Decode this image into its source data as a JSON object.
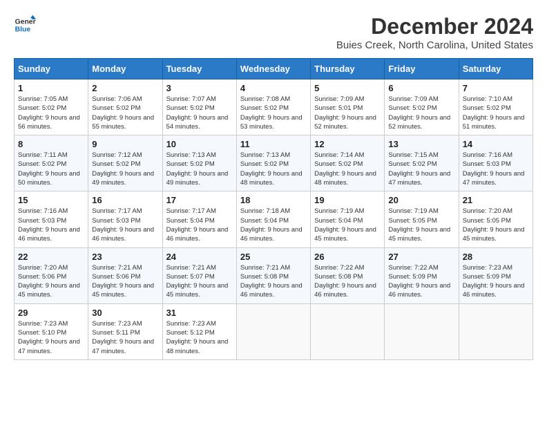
{
  "logo": {
    "line1": "General",
    "line2": "Blue"
  },
  "title": "December 2024",
  "location": "Buies Creek, North Carolina, United States",
  "weekdays": [
    "Sunday",
    "Monday",
    "Tuesday",
    "Wednesday",
    "Thursday",
    "Friday",
    "Saturday"
  ],
  "weeks": [
    [
      {
        "day": "1",
        "sunrise": "Sunrise: 7:05 AM",
        "sunset": "Sunset: 5:02 PM",
        "daylight": "Daylight: 9 hours and 56 minutes."
      },
      {
        "day": "2",
        "sunrise": "Sunrise: 7:06 AM",
        "sunset": "Sunset: 5:02 PM",
        "daylight": "Daylight: 9 hours and 55 minutes."
      },
      {
        "day": "3",
        "sunrise": "Sunrise: 7:07 AM",
        "sunset": "Sunset: 5:02 PM",
        "daylight": "Daylight: 9 hours and 54 minutes."
      },
      {
        "day": "4",
        "sunrise": "Sunrise: 7:08 AM",
        "sunset": "Sunset: 5:02 PM",
        "daylight": "Daylight: 9 hours and 53 minutes."
      },
      {
        "day": "5",
        "sunrise": "Sunrise: 7:09 AM",
        "sunset": "Sunset: 5:01 PM",
        "daylight": "Daylight: 9 hours and 52 minutes."
      },
      {
        "day": "6",
        "sunrise": "Sunrise: 7:09 AM",
        "sunset": "Sunset: 5:02 PM",
        "daylight": "Daylight: 9 hours and 52 minutes."
      },
      {
        "day": "7",
        "sunrise": "Sunrise: 7:10 AM",
        "sunset": "Sunset: 5:02 PM",
        "daylight": "Daylight: 9 hours and 51 minutes."
      }
    ],
    [
      {
        "day": "8",
        "sunrise": "Sunrise: 7:11 AM",
        "sunset": "Sunset: 5:02 PM",
        "daylight": "Daylight: 9 hours and 50 minutes."
      },
      {
        "day": "9",
        "sunrise": "Sunrise: 7:12 AM",
        "sunset": "Sunset: 5:02 PM",
        "daylight": "Daylight: 9 hours and 49 minutes."
      },
      {
        "day": "10",
        "sunrise": "Sunrise: 7:13 AM",
        "sunset": "Sunset: 5:02 PM",
        "daylight": "Daylight: 9 hours and 49 minutes."
      },
      {
        "day": "11",
        "sunrise": "Sunrise: 7:13 AM",
        "sunset": "Sunset: 5:02 PM",
        "daylight": "Daylight: 9 hours and 48 minutes."
      },
      {
        "day": "12",
        "sunrise": "Sunrise: 7:14 AM",
        "sunset": "Sunset: 5:02 PM",
        "daylight": "Daylight: 9 hours and 48 minutes."
      },
      {
        "day": "13",
        "sunrise": "Sunrise: 7:15 AM",
        "sunset": "Sunset: 5:02 PM",
        "daylight": "Daylight: 9 hours and 47 minutes."
      },
      {
        "day": "14",
        "sunrise": "Sunrise: 7:16 AM",
        "sunset": "Sunset: 5:03 PM",
        "daylight": "Daylight: 9 hours and 47 minutes."
      }
    ],
    [
      {
        "day": "15",
        "sunrise": "Sunrise: 7:16 AM",
        "sunset": "Sunset: 5:03 PM",
        "daylight": "Daylight: 9 hours and 46 minutes."
      },
      {
        "day": "16",
        "sunrise": "Sunrise: 7:17 AM",
        "sunset": "Sunset: 5:03 PM",
        "daylight": "Daylight: 9 hours and 46 minutes."
      },
      {
        "day": "17",
        "sunrise": "Sunrise: 7:17 AM",
        "sunset": "Sunset: 5:04 PM",
        "daylight": "Daylight: 9 hours and 46 minutes."
      },
      {
        "day": "18",
        "sunrise": "Sunrise: 7:18 AM",
        "sunset": "Sunset: 5:04 PM",
        "daylight": "Daylight: 9 hours and 46 minutes."
      },
      {
        "day": "19",
        "sunrise": "Sunrise: 7:19 AM",
        "sunset": "Sunset: 5:04 PM",
        "daylight": "Daylight: 9 hours and 45 minutes."
      },
      {
        "day": "20",
        "sunrise": "Sunrise: 7:19 AM",
        "sunset": "Sunset: 5:05 PM",
        "daylight": "Daylight: 9 hours and 45 minutes."
      },
      {
        "day": "21",
        "sunrise": "Sunrise: 7:20 AM",
        "sunset": "Sunset: 5:05 PM",
        "daylight": "Daylight: 9 hours and 45 minutes."
      }
    ],
    [
      {
        "day": "22",
        "sunrise": "Sunrise: 7:20 AM",
        "sunset": "Sunset: 5:06 PM",
        "daylight": "Daylight: 9 hours and 45 minutes."
      },
      {
        "day": "23",
        "sunrise": "Sunrise: 7:21 AM",
        "sunset": "Sunset: 5:06 PM",
        "daylight": "Daylight: 9 hours and 45 minutes."
      },
      {
        "day": "24",
        "sunrise": "Sunrise: 7:21 AM",
        "sunset": "Sunset: 5:07 PM",
        "daylight": "Daylight: 9 hours and 45 minutes."
      },
      {
        "day": "25",
        "sunrise": "Sunrise: 7:21 AM",
        "sunset": "Sunset: 5:08 PM",
        "daylight": "Daylight: 9 hours and 46 minutes."
      },
      {
        "day": "26",
        "sunrise": "Sunrise: 7:22 AM",
        "sunset": "Sunset: 5:08 PM",
        "daylight": "Daylight: 9 hours and 46 minutes."
      },
      {
        "day": "27",
        "sunrise": "Sunrise: 7:22 AM",
        "sunset": "Sunset: 5:09 PM",
        "daylight": "Daylight: 9 hours and 46 minutes."
      },
      {
        "day": "28",
        "sunrise": "Sunrise: 7:23 AM",
        "sunset": "Sunset: 5:09 PM",
        "daylight": "Daylight: 9 hours and 46 minutes."
      }
    ],
    [
      {
        "day": "29",
        "sunrise": "Sunrise: 7:23 AM",
        "sunset": "Sunset: 5:10 PM",
        "daylight": "Daylight: 9 hours and 47 minutes."
      },
      {
        "day": "30",
        "sunrise": "Sunrise: 7:23 AM",
        "sunset": "Sunset: 5:11 PM",
        "daylight": "Daylight: 9 hours and 47 minutes."
      },
      {
        "day": "31",
        "sunrise": "Sunrise: 7:23 AM",
        "sunset": "Sunset: 5:12 PM",
        "daylight": "Daylight: 9 hours and 48 minutes."
      },
      null,
      null,
      null,
      null
    ]
  ]
}
